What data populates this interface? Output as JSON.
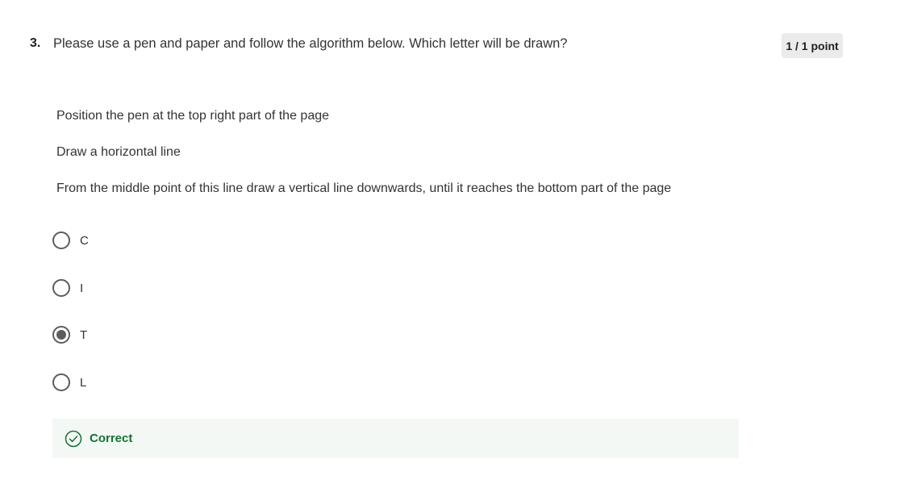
{
  "question": {
    "number": "3.",
    "text": "Please use a pen and paper and follow the algorithm below. Which letter will be drawn?",
    "score": "1 / 1 point"
  },
  "steps": [
    "Position the pen at the top right part of the page",
    "Draw a horizontal line",
    "From the middle point of this line draw a vertical line downwards, until it reaches the bottom part of the page"
  ],
  "options": [
    {
      "label": "C",
      "selected": false
    },
    {
      "label": "I",
      "selected": false
    },
    {
      "label": "T",
      "selected": true
    },
    {
      "label": "L",
      "selected": false
    }
  ],
  "feedback": {
    "label": "Correct",
    "icon": "check-circle-icon",
    "color": "#137333",
    "background": "#f3f8f5"
  }
}
